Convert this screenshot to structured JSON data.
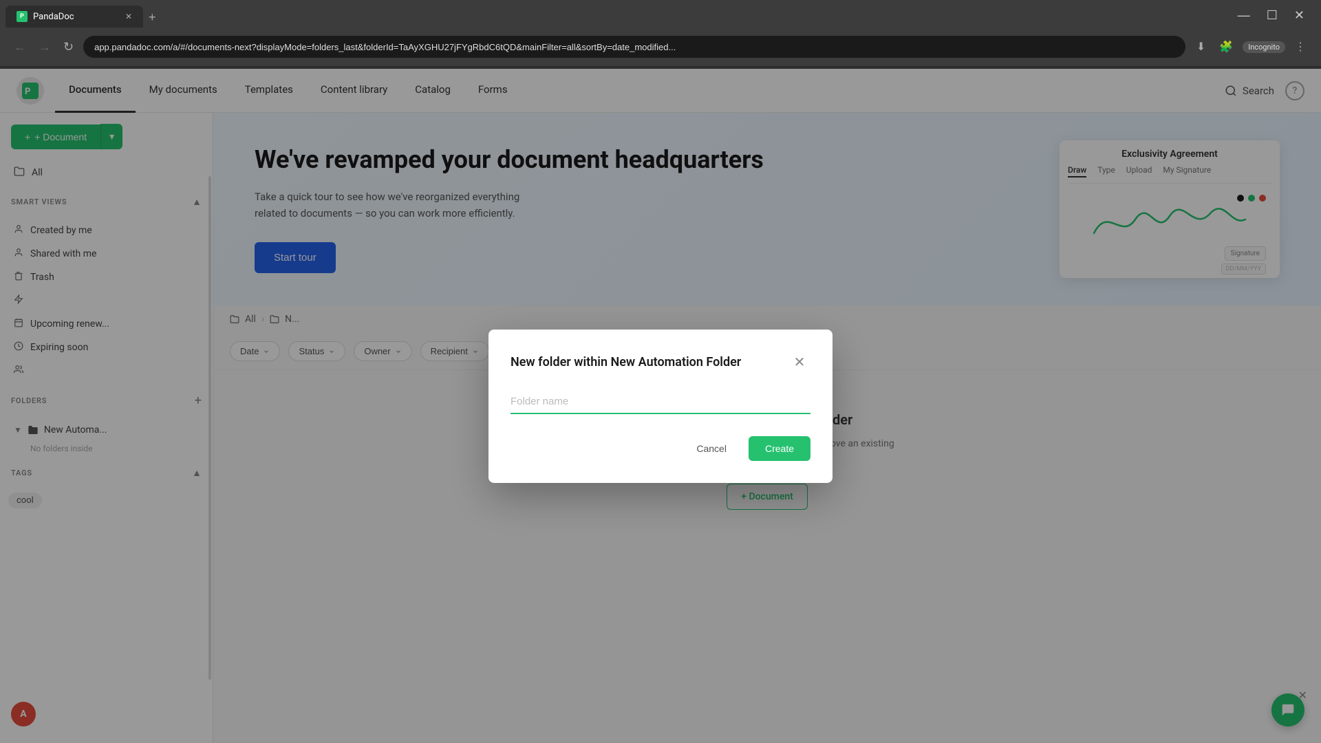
{
  "browser": {
    "tab_title": "PandaDoc",
    "tab_favicon": "P",
    "address": "app.pandadoc.com/a/#/documents-next?displayMode=folders_last&folderId=TaAyXGHU27jFYgRbdC6tQD&mainFilter=all&sortBy=date_modified...",
    "incognito_label": "Incognito",
    "window_controls": {
      "minimize": "—",
      "maximize": "☐",
      "close": "✕"
    }
  },
  "nav": {
    "logo_text": "P",
    "items": [
      {
        "label": "Documents",
        "active": true
      },
      {
        "label": "My documents",
        "active": false
      },
      {
        "label": "Templates",
        "active": false
      },
      {
        "label": "Content library",
        "active": false
      },
      {
        "label": "Catalog",
        "active": false
      },
      {
        "label": "Forms",
        "active": false
      }
    ],
    "search_label": "Search",
    "help_label": "?"
  },
  "sidebar": {
    "new_doc_btn": "+ Document",
    "nav_items": [
      {
        "label": "All",
        "icon": "📁"
      }
    ],
    "smart_views_title": "SMART VIEWS",
    "smart_view_items": [
      {
        "label": "Shared with me",
        "icon": "👤"
      },
      {
        "label": "Trash",
        "icon": "🗑"
      }
    ],
    "smart_views_extra": [
      {
        "label": "Created by me",
        "icon": "📄"
      },
      {
        "label": "Upcoming renew...",
        "icon": "📅"
      },
      {
        "label": "Expiring soon",
        "icon": "🕐"
      }
    ],
    "folders_title": "FOLDERS",
    "folder_items": [
      {
        "label": "New Automa...",
        "expanded": true
      }
    ],
    "folder_empty_label": "No folders inside",
    "tags_title": "TAGS",
    "tag_items": [
      {
        "label": "cool"
      }
    ]
  },
  "banner": {
    "title": "We've revamped your document headquarters",
    "description": "Take a quick tour to see how we've reorganized everything related to documents — so you can work more efficiently.",
    "cta_label": "Start tour",
    "doc_preview_title": "Exclusivity Agreement",
    "doc_preview_tabs": [
      "Draw",
      "Type",
      "Upload",
      "My Signature"
    ],
    "doc_preview_active_tab": "Draw"
  },
  "breadcrumb": {
    "items": [
      "All",
      "N..."
    ]
  },
  "filters": {
    "date_label": "Date",
    "status_label": "Status",
    "owner_label": "Owner",
    "recipient_label": "Recipient"
  },
  "empty_state": {
    "title": "No documents in this folder",
    "description": "Create a new one here, or go to your list to move an existing document into this folder.",
    "add_label": "+ Document"
  },
  "modal": {
    "title": "New folder within New Automation Folder",
    "input_placeholder": "Folder name",
    "cancel_label": "Cancel",
    "create_label": "Create"
  },
  "chat": {
    "icon": "💬"
  }
}
